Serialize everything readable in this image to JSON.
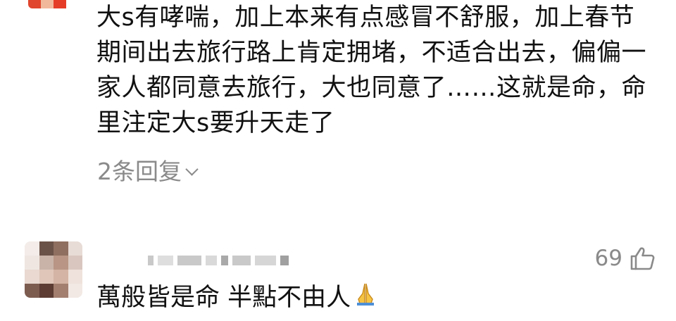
{
  "comment1": {
    "lines": [
      "大s有哮喘，加上本来有点感冒不舒服，加上春节",
      "期间出去旅行路上肯定拥堵，不适合出去，偏偏一",
      "家人都同意去旅行，大也同意了……这就是命，命",
      "里注定大s要升天走了"
    ],
    "replies_label": "2条回复"
  },
  "comment2": {
    "text": "萬般皆是命 半點不由人",
    "likes": "69",
    "emoji": "folded-hands"
  },
  "icons": {
    "like": "thumbs-up-icon",
    "expand": "chevron-down-icon"
  },
  "colors": {
    "text": "#111111",
    "muted": "#8a8a8a",
    "background": "#ffffff"
  }
}
